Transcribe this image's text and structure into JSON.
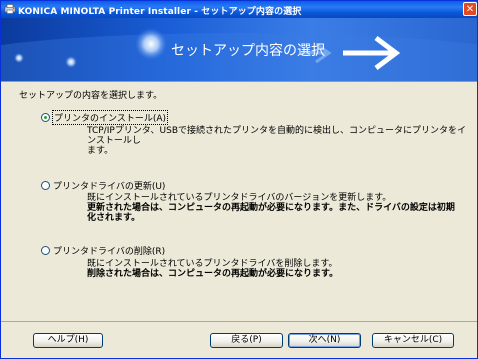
{
  "window": {
    "title": "KONICA MINOLTA Printer Installer - セットアップ内容の選択",
    "close_glyph": "✕"
  },
  "banner": {
    "title": "セットアップ内容の選択"
  },
  "instruction": "セットアップの内容を選択します。",
  "options": [
    {
      "label": "プリンタのインストール(A)",
      "checked": true,
      "description": [
        {
          "text": "TCP/IPプリンタ、USBで接続されたプリンタを自動的に検出し、コンピュータにプリンタをインストールし",
          "bold": false
        },
        {
          "text": "ます。",
          "bold": false
        }
      ]
    },
    {
      "label": "プリンタドライバの更新(U)",
      "checked": false,
      "description": [
        {
          "text": "既にインストールされているプリンタドライバのバージョンを更新します。",
          "bold": false
        },
        {
          "text": "更新された場合は、コンピュータの再起動が必要になります。また、ドライバの設定は初期",
          "bold": true
        },
        {
          "text": "化されます。",
          "bold": true
        }
      ]
    },
    {
      "label": "プリンタドライバの削除(R)",
      "checked": false,
      "description": [
        {
          "text": "既にインストールされているプリンタドライバを削除します。",
          "bold": false
        },
        {
          "text": "削除された場合は、コンピュータの再起動が必要になります。",
          "bold": true
        }
      ]
    }
  ],
  "buttons": {
    "help": "ヘルプ(H)",
    "back": "戻る(P)",
    "next": "次へ(N)",
    "cancel": "キャンセル(C)"
  },
  "colors": {
    "titlebar": "#0a5ce8",
    "banner": "#1a5ed8",
    "dialog_bg": "#ece9d8",
    "close": "#e34a21",
    "radio_dot": "#2aa22a"
  },
  "icons": {
    "app": "printer-app-icon",
    "close": "close-icon",
    "banner_arrow": "arrow-right-icon"
  }
}
